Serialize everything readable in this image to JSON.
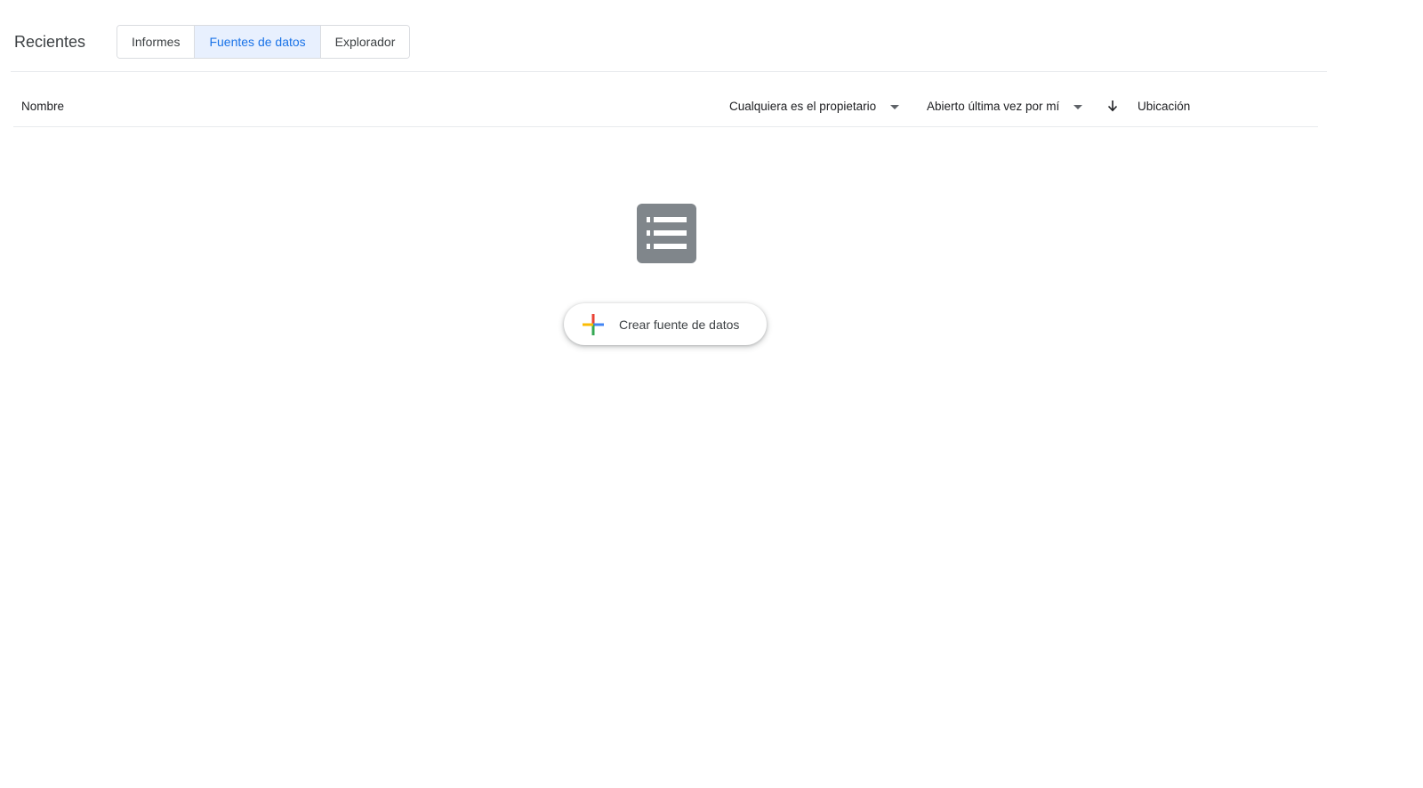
{
  "header": {
    "title": "Recientes",
    "tabs": [
      {
        "label": "Informes",
        "active": false
      },
      {
        "label": "Fuentes de datos",
        "active": true
      },
      {
        "label": "Explorador",
        "active": false
      }
    ]
  },
  "columns": {
    "name": "Nombre",
    "owner": "Cualquiera es el propietario",
    "opened": "Abierto última vez por mí",
    "location": "Ubicación"
  },
  "empty_state": {
    "icon": "list-icon",
    "create_label": "Crear fuente de datos"
  },
  "colors": {
    "active_tab_bg": "#e8f0fe",
    "active_tab_text": "#1a73e8",
    "icon_gray": "#80868b",
    "plus_blue": "#4285f4",
    "plus_red": "#ea4335",
    "plus_yellow": "#fbbc04",
    "plus_green": "#34a853"
  }
}
